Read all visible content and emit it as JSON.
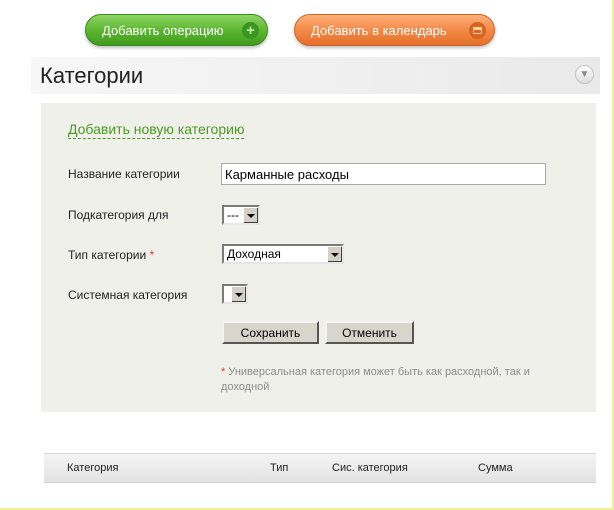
{
  "toolbar": {
    "add_operation": "Добавить операцию",
    "add_calendar": "Добавить в календарь"
  },
  "section": {
    "title": "Категории",
    "add_link": "Добавить новую категорию"
  },
  "form": {
    "name_label": "Название категории",
    "name_value": "Карманные расходы",
    "parent_label": "Подкатегория для",
    "parent_value": "---",
    "type_label": "Тип категории",
    "required_mark": "*",
    "type_value": "Доходная",
    "system_label": "Системная категория",
    "system_value": "",
    "save_label": "Сохранить",
    "cancel_label": "Отменить",
    "note_star": "*",
    "note_text": "Универсальная категория может быть как расходной, так и доходной"
  },
  "table": {
    "columns": [
      "Категория",
      "Тип",
      "Сис. категория",
      "Сумма"
    ]
  },
  "colors": {
    "green_button": "#5cb832",
    "orange_button": "#f48a48",
    "link_green": "#4a9a23",
    "required_red": "#d9372a",
    "panel_bg": "#f0f0eb"
  }
}
